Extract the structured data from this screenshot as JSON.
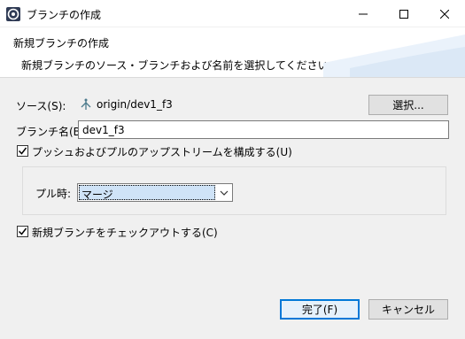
{
  "window": {
    "title": "ブランチの作成",
    "icon": "eclipse-app-icon",
    "controls": {
      "minimize": "minimize-icon",
      "maximize": "maximize-icon",
      "close": "close-icon"
    }
  },
  "header": {
    "title": "新規ブランチの作成",
    "message": "新規ブランチのソース・ブランチおよび名前を選択してください"
  },
  "form": {
    "source_label": "ソース(S):",
    "source_value": "origin/dev1_f3",
    "select_button": "選択...",
    "branch_name_label": "ブランチ名(B):",
    "branch_name_value": "dev1_f3",
    "configure_upstream_label": "プッシュおよびプルのアップストリームを構成する(U)",
    "configure_upstream_checked": true,
    "pull_label": "プル時:",
    "pull_value": "マージ",
    "checkout_label": "新規ブランチをチェックアウトする(C)",
    "checkout_checked": true
  },
  "footer": {
    "finish_button": "完了(F)",
    "cancel_button": "キャンセル"
  },
  "colors": {
    "accent": "#0078d7",
    "body_bg": "#f0f0f0"
  }
}
